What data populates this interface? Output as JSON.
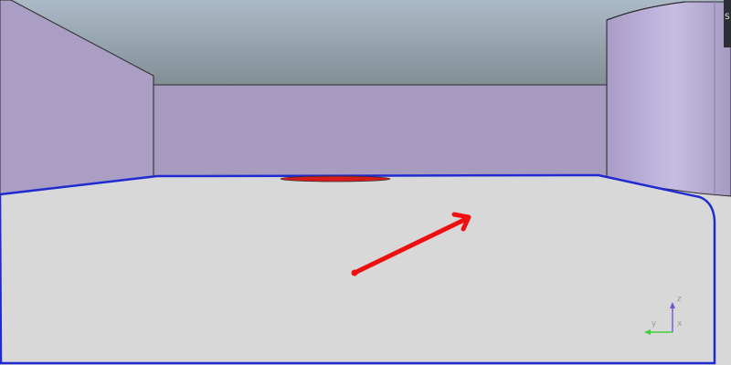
{
  "viewport": {
    "title": "",
    "colors": {
      "sky_top": "#a9b9c6",
      "sky_bottom": "#7f8c93",
      "wall": "#a99dc2",
      "wall_far": "#a59bbf",
      "column_light": "#c3b8e0",
      "floor": "#d8d8d8",
      "floor_outline": "#1f2bd0",
      "marker": "#e01818",
      "arrow": "#ee1010"
    }
  },
  "axes": {
    "z_label": "z",
    "y_label": "y",
    "x_label": "x",
    "z_color": "#7a4fd6",
    "y_color": "#3ccf3c",
    "x_color": "#9a9a9a"
  },
  "edge": {
    "label": "S"
  }
}
